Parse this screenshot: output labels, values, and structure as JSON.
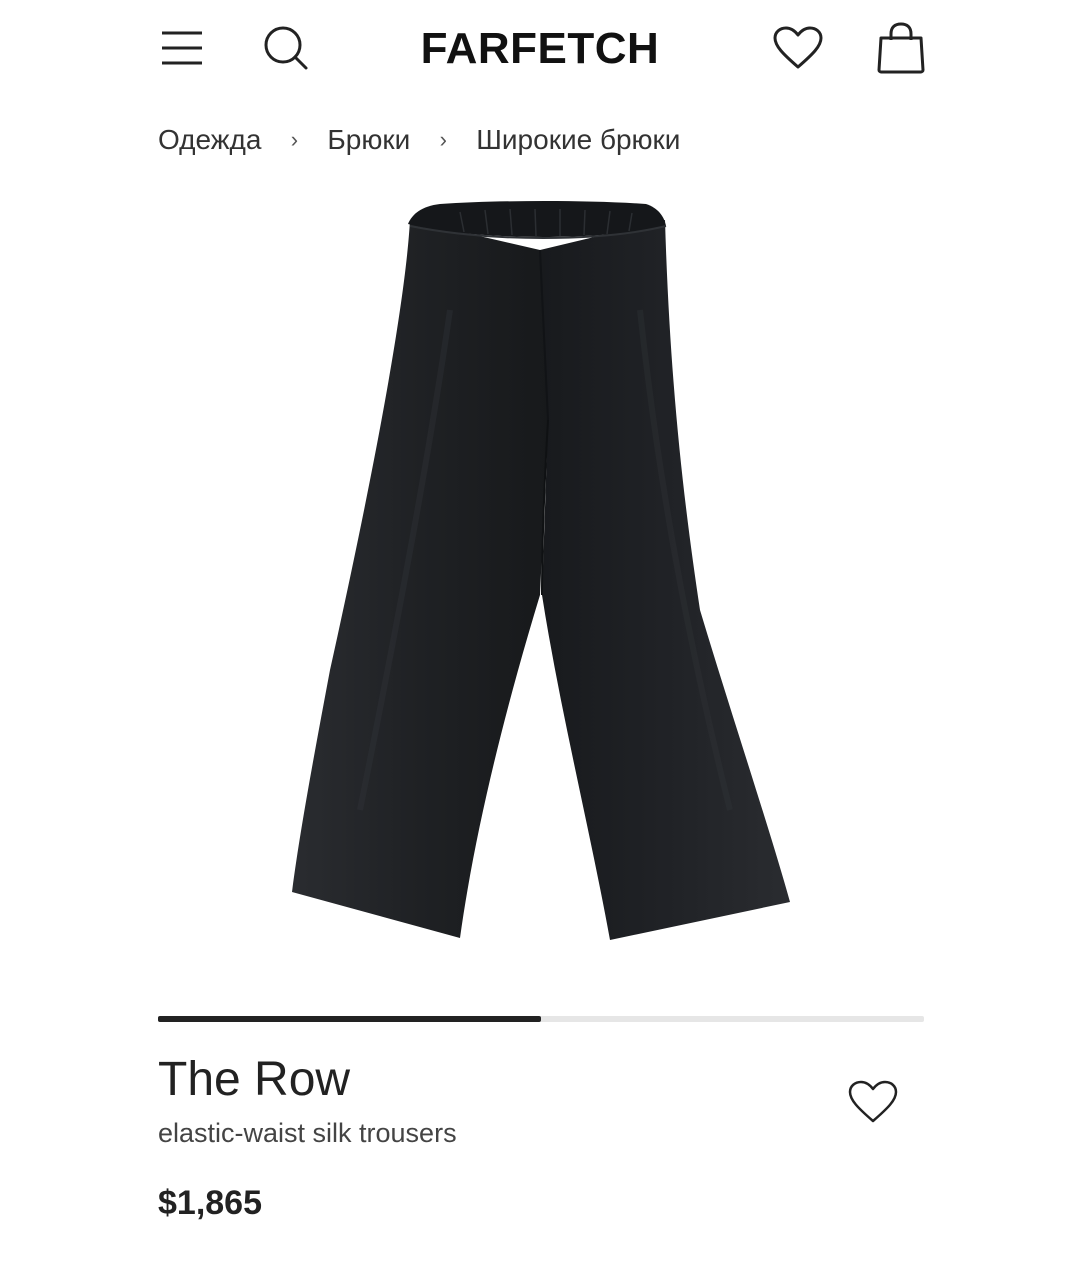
{
  "header": {
    "logo": "FARFETCH",
    "icons": [
      "menu-icon",
      "search-icon",
      "heart-icon",
      "shopping-bag-icon"
    ]
  },
  "breadcrumb": {
    "items": [
      {
        "label": "Одежда"
      },
      {
        "label": "Брюки"
      },
      {
        "label": "Широкие брюки"
      }
    ],
    "separator": "›"
  },
  "gallery": {
    "progress": 0.5,
    "image": "black wide-leg trousers"
  },
  "product": {
    "brand": "The Row",
    "description": "elastic-waist silk trousers",
    "price": "$1,865",
    "wishlist_icon": "heart-icon"
  },
  "colors": {
    "text": "#222222",
    "product_fabric": "#1f2124",
    "progress_track": "#e6e6e6",
    "progress_fill": "#222222"
  }
}
